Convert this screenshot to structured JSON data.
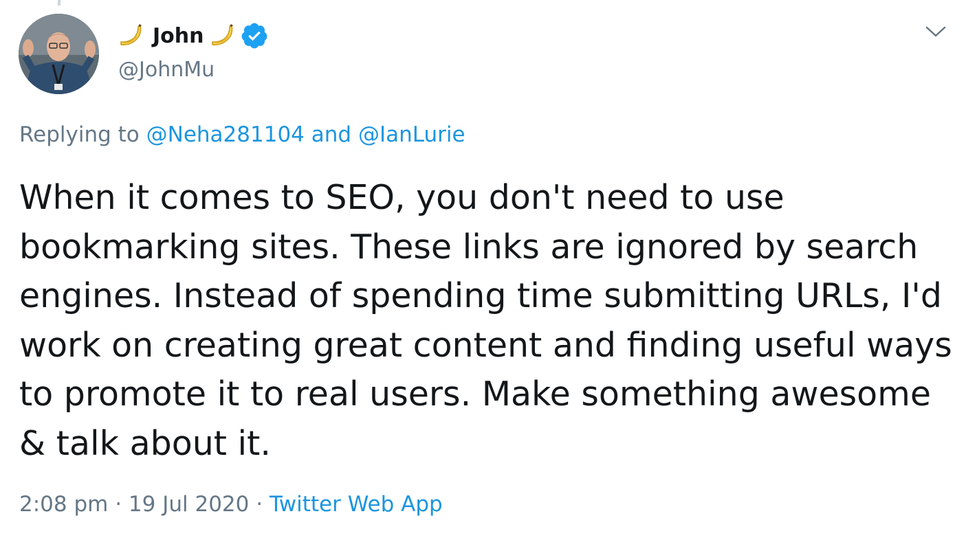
{
  "user": {
    "name": "John",
    "name_emoji_left": "banana-emoji",
    "name_emoji_right": "banana-emoji",
    "verified_icon": "verified-badge-icon",
    "handle": "@JohnMu",
    "avatar": "profile-photo"
  },
  "reply": {
    "prefix": "Replying to",
    "mention_1": "@Neha281104",
    "conjunction": "and",
    "mention_2": "@IanLurie"
  },
  "tweet": {
    "text": "When it comes to SEO, you don't need to use bookmarking sites. These links are ignored by search engines. Instead of spending time submitting URLs, I'd work on creating great content and finding useful ways to promote it to real users. Make something awesome & talk about it."
  },
  "meta": {
    "time": "2:08 pm",
    "separator_1": "·",
    "date": "19 Jul 2020",
    "separator_2": "·",
    "source": "Twitter Web App"
  },
  "icons": {
    "menu": "chevron-down-icon"
  },
  "colors": {
    "link": "#1b95e0",
    "secondary_text": "#657786",
    "primary_text": "#14171a",
    "verified": "#1da1f2"
  }
}
